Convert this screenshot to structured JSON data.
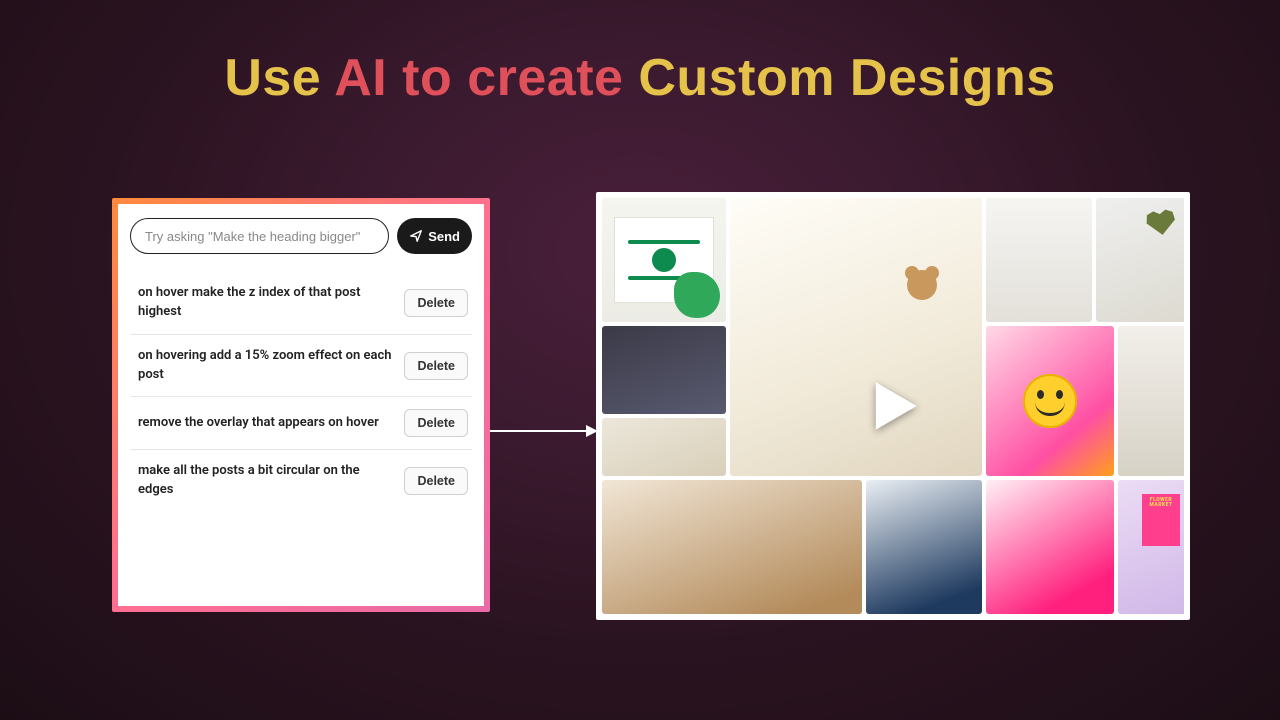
{
  "headline": {
    "part1": {
      "text": "Use ",
      "color": "#e5c24a"
    },
    "part2": {
      "text": "AI to create ",
      "color": "#e0505a"
    },
    "part3": {
      "text": "Custom Designs",
      "color": "#e5c24a"
    }
  },
  "chat": {
    "placeholder": "Try asking \"Make the heading bigger\"",
    "send_label": "Send",
    "delete_label": "Delete",
    "prompts": [
      "on hover make the z index of that post highest",
      "on hovering add a 15% zoom effect on each post",
      "remove the overlay that appears on hover",
      "make all the posts a bit circular on the edges"
    ]
  },
  "gallery": {
    "play_label": "Play",
    "flower_poster_text": "FLOWER MARKET"
  }
}
